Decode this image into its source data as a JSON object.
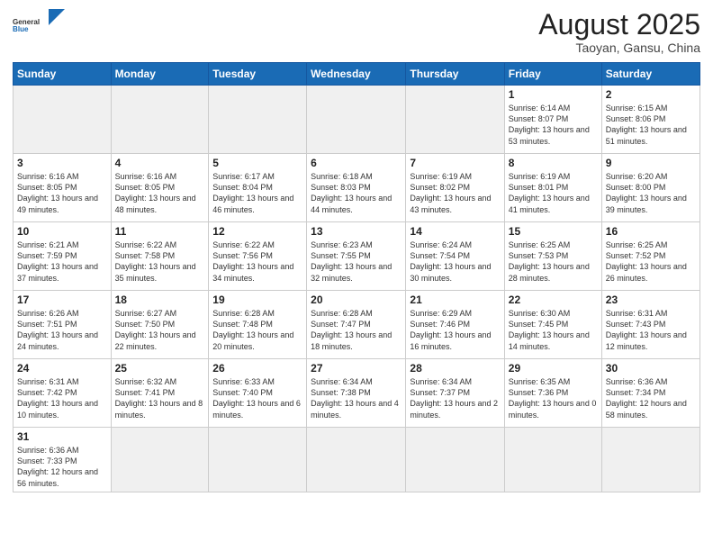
{
  "header": {
    "logo_general": "General",
    "logo_blue": "Blue",
    "month_year": "August 2025",
    "location": "Taoyan, Gansu, China"
  },
  "weekdays": [
    "Sunday",
    "Monday",
    "Tuesday",
    "Wednesday",
    "Thursday",
    "Friday",
    "Saturday"
  ],
  "weeks": [
    [
      {
        "day": "",
        "info": ""
      },
      {
        "day": "",
        "info": ""
      },
      {
        "day": "",
        "info": ""
      },
      {
        "day": "",
        "info": ""
      },
      {
        "day": "",
        "info": ""
      },
      {
        "day": "1",
        "info": "Sunrise: 6:14 AM\nSunset: 8:07 PM\nDaylight: 13 hours\nand 53 minutes."
      },
      {
        "day": "2",
        "info": "Sunrise: 6:15 AM\nSunset: 8:06 PM\nDaylight: 13 hours\nand 51 minutes."
      }
    ],
    [
      {
        "day": "3",
        "info": "Sunrise: 6:16 AM\nSunset: 8:05 PM\nDaylight: 13 hours\nand 49 minutes."
      },
      {
        "day": "4",
        "info": "Sunrise: 6:16 AM\nSunset: 8:05 PM\nDaylight: 13 hours\nand 48 minutes."
      },
      {
        "day": "5",
        "info": "Sunrise: 6:17 AM\nSunset: 8:04 PM\nDaylight: 13 hours\nand 46 minutes."
      },
      {
        "day": "6",
        "info": "Sunrise: 6:18 AM\nSunset: 8:03 PM\nDaylight: 13 hours\nand 44 minutes."
      },
      {
        "day": "7",
        "info": "Sunrise: 6:19 AM\nSunset: 8:02 PM\nDaylight: 13 hours\nand 43 minutes."
      },
      {
        "day": "8",
        "info": "Sunrise: 6:19 AM\nSunset: 8:01 PM\nDaylight: 13 hours\nand 41 minutes."
      },
      {
        "day": "9",
        "info": "Sunrise: 6:20 AM\nSunset: 8:00 PM\nDaylight: 13 hours\nand 39 minutes."
      }
    ],
    [
      {
        "day": "10",
        "info": "Sunrise: 6:21 AM\nSunset: 7:59 PM\nDaylight: 13 hours\nand 37 minutes."
      },
      {
        "day": "11",
        "info": "Sunrise: 6:22 AM\nSunset: 7:58 PM\nDaylight: 13 hours\nand 35 minutes."
      },
      {
        "day": "12",
        "info": "Sunrise: 6:22 AM\nSunset: 7:56 PM\nDaylight: 13 hours\nand 34 minutes."
      },
      {
        "day": "13",
        "info": "Sunrise: 6:23 AM\nSunset: 7:55 PM\nDaylight: 13 hours\nand 32 minutes."
      },
      {
        "day": "14",
        "info": "Sunrise: 6:24 AM\nSunset: 7:54 PM\nDaylight: 13 hours\nand 30 minutes."
      },
      {
        "day": "15",
        "info": "Sunrise: 6:25 AM\nSunset: 7:53 PM\nDaylight: 13 hours\nand 28 minutes."
      },
      {
        "day": "16",
        "info": "Sunrise: 6:25 AM\nSunset: 7:52 PM\nDaylight: 13 hours\nand 26 minutes."
      }
    ],
    [
      {
        "day": "17",
        "info": "Sunrise: 6:26 AM\nSunset: 7:51 PM\nDaylight: 13 hours\nand 24 minutes."
      },
      {
        "day": "18",
        "info": "Sunrise: 6:27 AM\nSunset: 7:50 PM\nDaylight: 13 hours\nand 22 minutes."
      },
      {
        "day": "19",
        "info": "Sunrise: 6:28 AM\nSunset: 7:48 PM\nDaylight: 13 hours\nand 20 minutes."
      },
      {
        "day": "20",
        "info": "Sunrise: 6:28 AM\nSunset: 7:47 PM\nDaylight: 13 hours\nand 18 minutes."
      },
      {
        "day": "21",
        "info": "Sunrise: 6:29 AM\nSunset: 7:46 PM\nDaylight: 13 hours\nand 16 minutes."
      },
      {
        "day": "22",
        "info": "Sunrise: 6:30 AM\nSunset: 7:45 PM\nDaylight: 13 hours\nand 14 minutes."
      },
      {
        "day": "23",
        "info": "Sunrise: 6:31 AM\nSunset: 7:43 PM\nDaylight: 13 hours\nand 12 minutes."
      }
    ],
    [
      {
        "day": "24",
        "info": "Sunrise: 6:31 AM\nSunset: 7:42 PM\nDaylight: 13 hours\nand 10 minutes."
      },
      {
        "day": "25",
        "info": "Sunrise: 6:32 AM\nSunset: 7:41 PM\nDaylight: 13 hours\nand 8 minutes."
      },
      {
        "day": "26",
        "info": "Sunrise: 6:33 AM\nSunset: 7:40 PM\nDaylight: 13 hours\nand 6 minutes."
      },
      {
        "day": "27",
        "info": "Sunrise: 6:34 AM\nSunset: 7:38 PM\nDaylight: 13 hours\nand 4 minutes."
      },
      {
        "day": "28",
        "info": "Sunrise: 6:34 AM\nSunset: 7:37 PM\nDaylight: 13 hours\nand 2 minutes."
      },
      {
        "day": "29",
        "info": "Sunrise: 6:35 AM\nSunset: 7:36 PM\nDaylight: 13 hours\nand 0 minutes."
      },
      {
        "day": "30",
        "info": "Sunrise: 6:36 AM\nSunset: 7:34 PM\nDaylight: 12 hours\nand 58 minutes."
      }
    ],
    [
      {
        "day": "31",
        "info": "Sunrise: 6:36 AM\nSunset: 7:33 PM\nDaylight: 12 hours\nand 56 minutes."
      },
      {
        "day": "",
        "info": ""
      },
      {
        "day": "",
        "info": ""
      },
      {
        "day": "",
        "info": ""
      },
      {
        "day": "",
        "info": ""
      },
      {
        "day": "",
        "info": ""
      },
      {
        "day": "",
        "info": ""
      }
    ]
  ]
}
